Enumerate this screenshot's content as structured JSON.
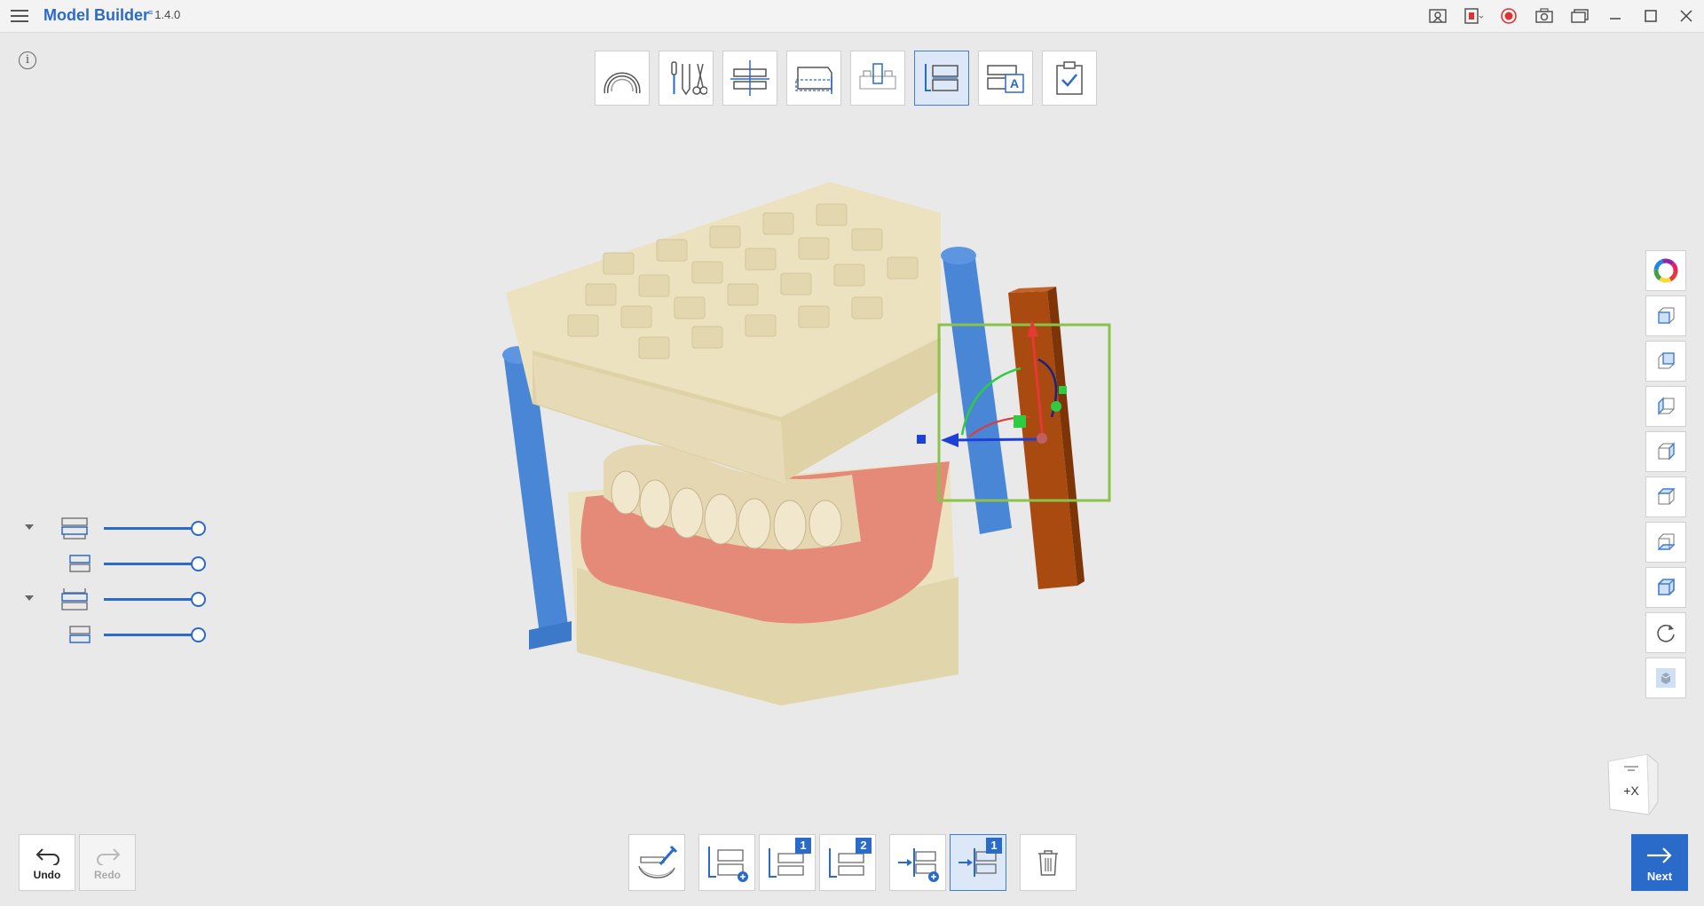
{
  "app": {
    "title": "Model Builder",
    "version": "1.4.0"
  },
  "titlebar_icons": [
    "screen-capture-icon",
    "record-region-icon",
    "record-icon",
    "camera-icon",
    "gallery-icon",
    "minimize-icon",
    "maximize-icon",
    "close-icon"
  ],
  "top_toolbar": {
    "steps": [
      {
        "name": "arch-step",
        "icon": "dental-arch-icon",
        "active": false
      },
      {
        "name": "trim-tools-step",
        "icon": "trim-tools-icon",
        "active": false
      },
      {
        "name": "alignment-step",
        "icon": "alignment-plane-icon",
        "active": false
      },
      {
        "name": "base-step",
        "icon": "model-base-icon",
        "active": false
      },
      {
        "name": "die-step",
        "icon": "die-icon",
        "active": false
      },
      {
        "name": "articulator-step",
        "icon": "articulator-connector-icon",
        "active": true
      },
      {
        "name": "label-step",
        "icon": "label-text-icon",
        "active": false
      },
      {
        "name": "complete-step",
        "icon": "checklist-icon",
        "active": false
      }
    ]
  },
  "sliders": [
    {
      "name": "upper-model-opacity",
      "expandable": true,
      "value": 1.0
    },
    {
      "name": "upper-scan-opacity",
      "expandable": false,
      "value": 1.0
    },
    {
      "name": "lower-model-opacity",
      "expandable": true,
      "value": 1.0
    },
    {
      "name": "lower-scan-opacity",
      "expandable": false,
      "value": 1.0
    }
  ],
  "right_toolbar": [
    "color-wheel-icon",
    "view-front-cube-icon",
    "view-back-cube-icon",
    "view-left-cube-icon",
    "view-right-cube-icon",
    "view-top-cube-icon",
    "view-bottom-cube-icon",
    "view-iso-cube-icon",
    "reset-view-icon",
    "texture-toggle-icon"
  ],
  "navcube": {
    "label": "+X"
  },
  "undo": {
    "label": "Undo"
  },
  "redo": {
    "label": "Redo"
  },
  "bottom_toolbar": [
    {
      "name": "scan-brush-button",
      "icon": "brush-scan-icon",
      "badge": ""
    },
    {
      "name": "add-connector-button",
      "icon": "add-connector-icon",
      "badge": ""
    },
    {
      "name": "connector-1-button",
      "icon": "connector-icon",
      "badge": "1"
    },
    {
      "name": "connector-2-button",
      "icon": "connector-icon",
      "badge": "2"
    },
    {
      "name": "insert-connector-button",
      "icon": "insert-connector-icon",
      "badge": ""
    },
    {
      "name": "move-connector-1-button",
      "icon": "move-connector-icon",
      "badge": "1",
      "active": true
    },
    {
      "name": "delete-button",
      "icon": "trash-icon",
      "badge": ""
    }
  ],
  "next": {
    "label": "Next"
  },
  "colors": {
    "accent": "#2a6ac8",
    "model_base": "#ece2c0",
    "gum": "#e58a78",
    "connector_rod": "#4a86d6",
    "plate": "#a94a10",
    "selection_box": "#8bc34a"
  }
}
